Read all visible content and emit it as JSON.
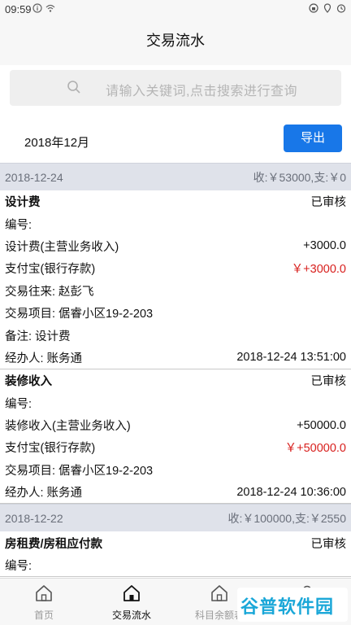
{
  "status_bar": {
    "time": "09:59"
  },
  "header": {
    "title": "交易流水"
  },
  "search": {
    "placeholder": "请输入关键词,点击搜索进行查询"
  },
  "month": {
    "label": "2018年12月",
    "export_label": "导出"
  },
  "groups": [
    {
      "date": "2018-12-24",
      "summary": "收:￥53000,支:￥0",
      "records": [
        {
          "title": "设计费",
          "status": "已审核",
          "number_label": "编号:",
          "account_name": "设计费(主营业务收入)",
          "account_amount": "+3000.0",
          "pay_name": "支付宝(银行存款)",
          "pay_amount": "￥+3000.0",
          "counterparty": "交易往来:  赵彭飞",
          "project": "交易项目:  倨睿小区19-2-203",
          "remark": "备注:  设计费",
          "operator": "经办人:  账务通",
          "datetime": "2018-12-24 13:51:00"
        },
        {
          "title": "装修收入",
          "status": "已审核",
          "number_label": "编号:",
          "account_name": "装修收入(主营业务收入)",
          "account_amount": "+50000.0",
          "pay_name": "支付宝(银行存款)",
          "pay_amount": "￥+50000.0",
          "project": "交易项目:  倨睿小区19-2-203",
          "operator": "经办人:  账务通",
          "datetime": "2018-12-24 10:36:00"
        }
      ]
    },
    {
      "date": "2018-12-22",
      "summary": "收:￥100000,支:￥2550",
      "records": [
        {
          "title": "房租费/房租应付款",
          "status": "已审核",
          "number_label": "编号:"
        }
      ]
    }
  ],
  "bottom_nav": {
    "items": [
      {
        "label": "首页",
        "icon": "home-icon"
      },
      {
        "label": "交易流水",
        "icon": "home-icon"
      },
      {
        "label": "科目余额表",
        "icon": "home-icon"
      },
      {
        "label": "我的",
        "icon": "user-icon"
      }
    ]
  },
  "watermark": {
    "text": "谷普软件园"
  },
  "colors": {
    "accent": "#1877e8",
    "amount_red": "#d8201e",
    "date_header_bg": "#dfe2ea"
  }
}
